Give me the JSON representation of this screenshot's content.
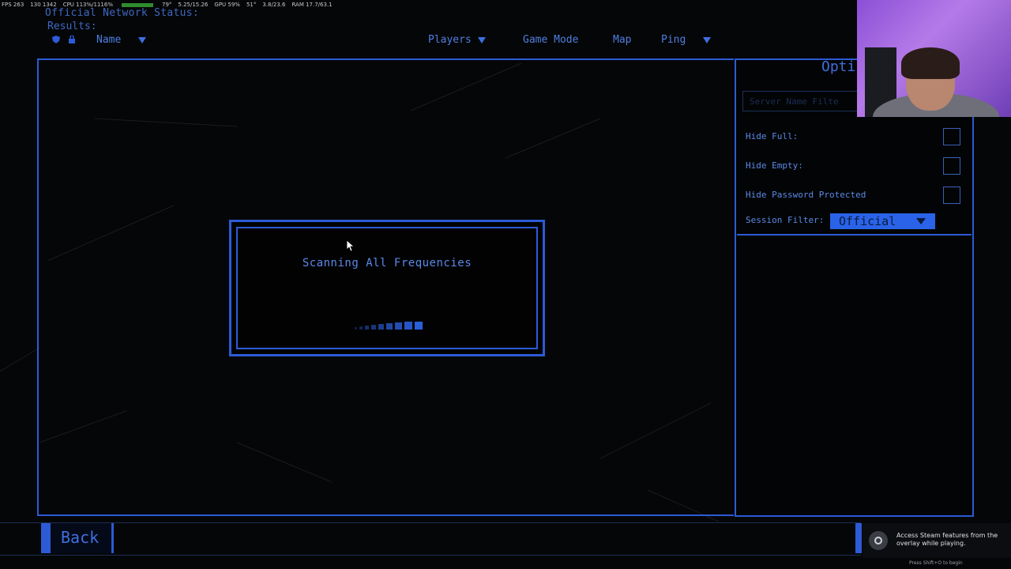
{
  "perf_overlay": {
    "fps": "FPS 263",
    "fps_detail": "130 1342",
    "cpu": "CPU 113%/1116%",
    "cpu_temp": "79°",
    "cpu_clock": "5.25/15.26",
    "gpu": "GPU 59%",
    "gpu_temp": "51°",
    "gpu_mem": "3.8/23.6",
    "ram": "RAM 17.7/63.1"
  },
  "header": {
    "status": "Official Network Status:",
    "results": "Results:"
  },
  "columns": {
    "name": "Name",
    "players": "Players",
    "game_mode": "Game Mode",
    "map": "Map",
    "ping": "Ping"
  },
  "options": {
    "title": "Opti",
    "server_filter_placeholder": "Server Name Filte",
    "hide_full": "Hide Full:",
    "hide_empty": "Hide Empty:",
    "hide_password": "Hide Password Protected",
    "session_filter_label": "Session Filter:",
    "session_filter_value": "Official"
  },
  "dialog": {
    "title": "Scanning All Frequencies",
    "progress_steps": 9
  },
  "footer": {
    "back": "Back"
  },
  "toast": {
    "message": "Access Steam features from the overlay while playing.",
    "hint": "Press Shift+O to begin"
  },
  "colors": {
    "accent": "#2c5bd6",
    "text": "#4a7bd8",
    "background": "#050607"
  }
}
